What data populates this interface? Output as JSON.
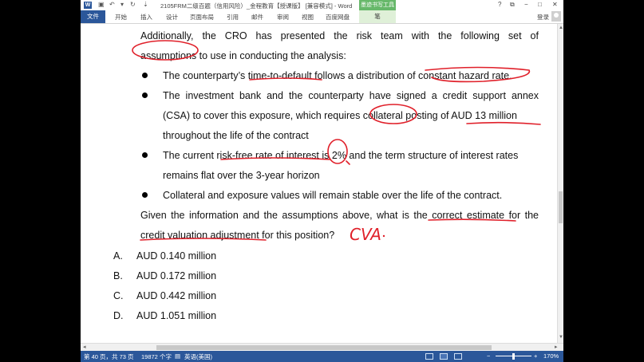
{
  "titlebar": {
    "app_icon": "W",
    "document_title": "2105FRM二级百题（信用风险）_金程教育【授课版】 [兼容模式] - Word",
    "context_tab_group": "墨迹书写工具",
    "help": "?",
    "restore": "⧉",
    "minimize": "−",
    "maximize": "□",
    "close": "✕"
  },
  "ribbon": {
    "file_tab": "文件",
    "tabs": [
      "开始",
      "插入",
      "设计",
      "页面布局",
      "引用",
      "邮件",
      "审阅",
      "视图",
      "百度网盘"
    ],
    "context_tab": "笔",
    "login": "登录"
  },
  "document": {
    "intro_line1": "Additionally, the CRO has presented the risk team with the following set of",
    "intro_line2": "assumptions to use in conducting the analysis:",
    "bullets": [
      {
        "lines": [
          "The counterparty’s time-to-default follows a distribution of constant hazard rate."
        ]
      },
      {
        "lines": [
          "The investment bank and the counterparty have signed a credit support annex",
          "(CSA) to cover this exposure, which requires collateral posting of AUD 13 million",
          "throughout the life of the contract"
        ]
      },
      {
        "lines": [
          "The current risk-free rate of interest is 2% and the term structure of interest rates",
          "remains flat over the 3-year horizon"
        ]
      },
      {
        "lines": [
          "Collateral and exposure values will remain stable over the life of the contract."
        ]
      }
    ],
    "question_line1": "Given the information and the assumptions above, what is the correct estimate for the",
    "question_line2": "credit valuation adjustment for this position?",
    "handwritten_note": "CVA",
    "options": [
      {
        "letter": "A.",
        "text": "AUD 0.140 million"
      },
      {
        "letter": "B.",
        "text": "AUD 0.172 million"
      },
      {
        "letter": "C.",
        "text": "AUD 0.442 million"
      },
      {
        "letter": "D.",
        "text": "AUD 1.051 million"
      }
    ]
  },
  "statusbar": {
    "page_info": "第 40 页，共 73 页",
    "word_count": "19872 个字",
    "language": "英语(美国)",
    "zoom": "170%"
  },
  "colors": {
    "word_blue": "#2b579a",
    "ink_red": "#e0202a",
    "context_green": "#67b86a"
  }
}
